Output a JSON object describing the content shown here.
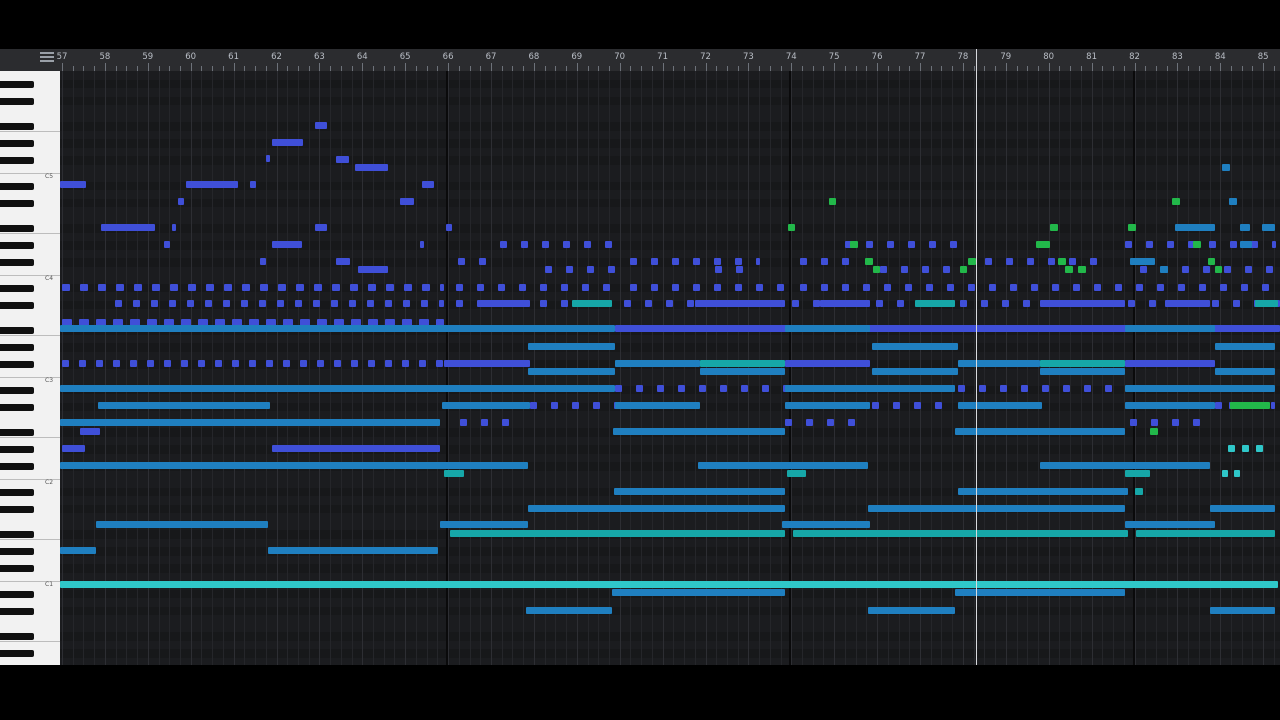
{
  "toolbar": {
    "menu_icon": "hamburger-menu-icon"
  },
  "timeline": {
    "bars": [
      "57",
      "58",
      "59",
      "60",
      "61",
      "62",
      "63",
      "64",
      "65",
      "66",
      "67",
      "68",
      "69",
      "70",
      "71",
      "72",
      "73",
      "74",
      "75",
      "76",
      "77",
      "78",
      "79",
      "80",
      "81",
      "82",
      "83",
      "84",
      "85"
    ],
    "playhead_bar": 78.3
  },
  "keyboard": {
    "octave_labels": [
      "C5",
      "C4",
      "C3",
      "C2",
      "C1"
    ]
  },
  "colors": {
    "violet": "#3f4fd8",
    "blue": "#1f7fc0",
    "teal": "#16a7a8",
    "aqua": "#2fc7c9",
    "green": "#22b84a"
  }
}
